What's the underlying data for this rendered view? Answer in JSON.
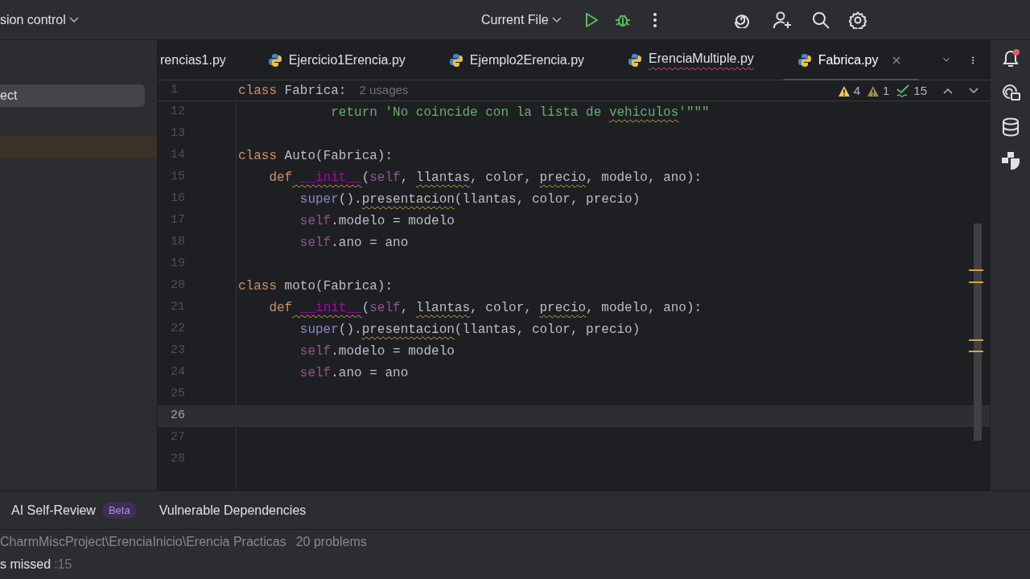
{
  "toolbar": {
    "vcs_label": "sion control",
    "run_config": "Current File"
  },
  "project_panel": {
    "items": [
      {
        "label": "ect",
        "selected": true,
        "highlighted": false
      },
      {
        "selected": false,
        "highlighted": true
      }
    ]
  },
  "tabs": [
    {
      "label": "rencias1.py",
      "kind": "clipped",
      "selected": false,
      "has_errors": false
    },
    {
      "label": "Ejercicio1Erencia.py",
      "kind": "python",
      "selected": false,
      "has_errors": false
    },
    {
      "label": "Ejemplo2Erencia.py",
      "kind": "python",
      "selected": false,
      "has_errors": false
    },
    {
      "label": "ErenciaMultiple.py",
      "kind": "python",
      "selected": false,
      "has_errors": true
    },
    {
      "label": "Fabrica.py",
      "kind": "python",
      "selected": true,
      "has_errors": false
    }
  ],
  "inspections": [
    {
      "kind": "warning",
      "count": "4"
    },
    {
      "kind": "weak",
      "count": "1"
    },
    {
      "kind": "typo",
      "count": "15"
    }
  ],
  "sticky_line": {
    "number": "1",
    "tokens": [
      {
        "text": "class",
        "kind": "kw"
      },
      {
        "text": " Fabrica:",
        "kind": "plain"
      }
    ],
    "hint": "2 usages"
  },
  "lines": [
    {
      "number": "12",
      "current": false,
      "tokens": [
        {
          "text": "            return 'No coincide con la lista de ",
          "kind": "str"
        },
        {
          "text": "vehiculos",
          "kind": "str_typo"
        },
        {
          "text": "'\"\"\"",
          "kind": "str"
        }
      ]
    },
    {
      "number": "13",
      "current": false
    },
    {
      "number": "14",
      "current": false,
      "tokens": [
        {
          "text": "class",
          "kind": "kw"
        },
        {
          "text": " Auto(Fabrica):",
          "kind": "plain"
        }
      ]
    },
    {
      "number": "15",
      "current": false,
      "tokens": [
        {
          "text": "    def",
          "kind": "kw"
        },
        {
          "text": " __init__",
          "kind": "magic_warn"
        },
        {
          "text": "(",
          "kind": "plain"
        },
        {
          "text": "self",
          "kind": "self"
        },
        {
          "text": ", ",
          "kind": "plain"
        },
        {
          "text": "llantas",
          "kind": "plain_typo"
        },
        {
          "text": ", color, ",
          "kind": "plain"
        },
        {
          "text": "precio",
          "kind": "plain_typo"
        },
        {
          "text": ", modelo, ano):",
          "kind": "plain"
        }
      ]
    },
    {
      "number": "16",
      "current": false,
      "tokens": [
        {
          "text": "        super",
          "kind": "builtin"
        },
        {
          "text": "().",
          "kind": "plain"
        },
        {
          "text": "presentacion",
          "kind": "plain_typo"
        },
        {
          "text": "(llantas, color, precio)",
          "kind": "plain"
        }
      ]
    },
    {
      "number": "17",
      "current": false,
      "tokens": [
        {
          "text": "        self",
          "kind": "self"
        },
        {
          "text": ".modelo = modelo",
          "kind": "plain"
        }
      ]
    },
    {
      "number": "18",
      "current": false,
      "tokens": [
        {
          "text": "        self",
          "kind": "self"
        },
        {
          "text": ".ano = ano",
          "kind": "plain"
        }
      ]
    },
    {
      "number": "19",
      "current": false
    },
    {
      "number": "20",
      "current": false,
      "tokens": [
        {
          "text": "class",
          "kind": "kw"
        },
        {
          "text": " moto(Fabrica):",
          "kind": "plain"
        }
      ]
    },
    {
      "number": "21",
      "current": false,
      "tokens": [
        {
          "text": "    def",
          "kind": "kw"
        },
        {
          "text": " __init__",
          "kind": "magic_warn"
        },
        {
          "text": "(",
          "kind": "plain"
        },
        {
          "text": "self",
          "kind": "self"
        },
        {
          "text": ", ",
          "kind": "plain"
        },
        {
          "text": "llantas",
          "kind": "plain_typo"
        },
        {
          "text": ", color, ",
          "kind": "plain"
        },
        {
          "text": "precio",
          "kind": "plain_typo"
        },
        {
          "text": ", modelo, ano):",
          "kind": "plain"
        }
      ]
    },
    {
      "number": "22",
      "current": false,
      "tokens": [
        {
          "text": "        super",
          "kind": "builtin"
        },
        {
          "text": "().",
          "kind": "plain"
        },
        {
          "text": "presentacion",
          "kind": "plain_typo"
        },
        {
          "text": "(llantas, color, precio)",
          "kind": "plain"
        }
      ]
    },
    {
      "number": "23",
      "current": false,
      "tokens": [
        {
          "text": "        self",
          "kind": "self"
        },
        {
          "text": ".modelo = modelo",
          "kind": "plain"
        }
      ]
    },
    {
      "number": "24",
      "current": false,
      "tokens": [
        {
          "text": "        self",
          "kind": "self"
        },
        {
          "text": ".ano = ano",
          "kind": "plain"
        }
      ]
    },
    {
      "number": "25",
      "current": false
    },
    {
      "number": "26",
      "current": true
    },
    {
      "number": "27",
      "current": false
    },
    {
      "number": "28",
      "current": false
    }
  ],
  "bottom_panel": {
    "tabs": [
      {
        "label": "AI Self-Review",
        "badge": "Beta"
      },
      {
        "label": "Vulnerable Dependencies"
      }
    ],
    "path": "CharmMiscProject\\ErenciaInicio\\Erencia Practicas",
    "problems": "20 problems",
    "missed_label": "s missed",
    "missed_count": ":15"
  }
}
